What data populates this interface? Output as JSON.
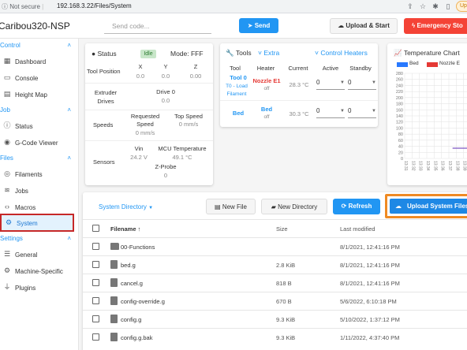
{
  "browser": {
    "info_icon": "info-icon",
    "security_label": "Not secure",
    "url": "192.168.3.22/Files/System",
    "avatar_text": "Up"
  },
  "app": {
    "title": "Caribou320-NSP",
    "gcode_placeholder": "Send code...",
    "send_label": "Send",
    "upload_start_label": "Upload & Start",
    "estop_label": "Emergency Sto"
  },
  "sidebar": {
    "sections": [
      {
        "label": "Control",
        "items": [
          {
            "label": "Dashboard",
            "icon": "dashboard-icon"
          },
          {
            "label": "Console",
            "icon": "console-icon"
          },
          {
            "label": "Height Map",
            "icon": "grid-icon"
          }
        ]
      },
      {
        "label": "Job",
        "items": [
          {
            "label": "Status",
            "icon": "info-icon"
          },
          {
            "label": "G-Code Viewer",
            "icon": "viewer-icon"
          }
        ]
      },
      {
        "label": "Files",
        "items": [
          {
            "label": "Filaments",
            "icon": "filament-icon"
          },
          {
            "label": "Jobs",
            "icon": "layers-icon"
          },
          {
            "label": "Macros",
            "icon": "code-icon"
          },
          {
            "label": "System",
            "icon": "gear-icon"
          }
        ]
      },
      {
        "label": "Settings",
        "items": [
          {
            "label": "General",
            "icon": "sliders-icon"
          },
          {
            "label": "Machine-Specific",
            "icon": "gears-icon"
          },
          {
            "label": "Plugins",
            "icon": "plug-icon"
          }
        ]
      }
    ]
  },
  "status": {
    "title": "Status",
    "state": "Idle",
    "mode": "Mode: FFF",
    "tool_position_label": "Tool Position",
    "axes": [
      "X",
      "Y",
      "Z"
    ],
    "axis_values": [
      "0.0",
      "0.0",
      "0.00"
    ],
    "extruder_label": "Extruder Drives",
    "drive_label": "Drive 0",
    "drive_value": "0.0",
    "speeds_label": "Speeds",
    "requested_speed_label": "Requested Speed",
    "requested_speed_value": "0 mm/s",
    "top_speed_label": "Top Speed",
    "top_speed_value": "0 mm/s",
    "sensors_label": "Sensors",
    "vin_label": "Vin",
    "vin_value": "24.2 V",
    "mcu_label": "MCU Temperature",
    "mcu_value": "49.1 °C",
    "zprobe_label": "Z-Probe",
    "zprobe_value": "0"
  },
  "tools": {
    "title": "Tools",
    "extra_label": "Extra",
    "control_heaters_label": "Control Heaters",
    "headers": [
      "Tool",
      "Heater",
      "Current",
      "Active",
      "Standby"
    ],
    "rows": [
      {
        "tool": "Tool 0",
        "sub": "T0 - Load Filament",
        "heater": "Nozzle E1",
        "heater_state": "off",
        "current": "28.3 °C",
        "active": "0",
        "standby": "0"
      },
      {
        "tool": "Bed",
        "sub": "",
        "heater": "Bed",
        "heater_state": "off",
        "current": "30.3 °C",
        "active": "0",
        "standby": "0"
      }
    ]
  },
  "temp_chart": {
    "title": "Temperature Chart",
    "legend": [
      {
        "name": "Bed",
        "color": "#2979ff"
      },
      {
        "name": "Nozzle E",
        "color": "#e53935"
      }
    ],
    "y_ticks": [
      "280",
      "260",
      "240",
      "220",
      "200",
      "180",
      "160",
      "140",
      "120",
      "100",
      "80",
      "60",
      "40",
      "20",
      "0"
    ],
    "x_ticks": [
      "13:31",
      "13:32",
      "13:33",
      "13:34",
      "13:35",
      "13:36",
      "13:37",
      "13:38",
      "13:39",
      "13:40"
    ]
  },
  "files": {
    "directory_label": "System Directory",
    "new_file_label": "New File",
    "new_directory_label": "New Directory",
    "refresh_label": "Refresh",
    "upload_label": "Upload System Files",
    "columns": {
      "name": "Filename",
      "size": "Size",
      "modified": "Last modified"
    },
    "rows": [
      {
        "name": "00-Functions",
        "type": "folder",
        "size": "",
        "modified": "8/1/2021, 12:41:16 PM"
      },
      {
        "name": "bed.g",
        "type": "file",
        "size": "2.8 KiB",
        "modified": "8/1/2021, 12:41:16 PM"
      },
      {
        "name": "cancel.g",
        "type": "file",
        "size": "818 B",
        "modified": "8/1/2021, 12:41:16 PM"
      },
      {
        "name": "config-override.g",
        "type": "file",
        "size": "670 B",
        "modified": "5/6/2022, 6:10:18 PM"
      },
      {
        "name": "config.g",
        "type": "file",
        "size": "9.3 KiB",
        "modified": "5/10/2022, 1:37:12 PM"
      },
      {
        "name": "config.g.bak",
        "type": "file",
        "size": "9.3 KiB",
        "modified": "1/11/2022, 4:37:40 PM"
      }
    ]
  }
}
